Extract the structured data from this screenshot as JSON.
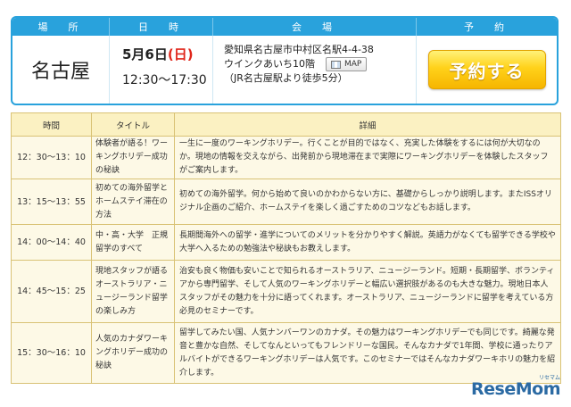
{
  "event": {
    "headers": {
      "venue": "場　所",
      "datetime": "日　時",
      "place": "会　場",
      "reserve": "予　約"
    },
    "venue_city": "名古屋",
    "date_day": "5月6日",
    "date_dow": "(日)",
    "time": "12:30〜17:30",
    "address": "愛知県名古屋市中村区名駅4-4-38",
    "building": "ウインクあいち10階",
    "map_label": "MAP",
    "access": "（JR名古屋駅より徒歩5分）",
    "reserve_button": "予約する"
  },
  "schedule": {
    "headers": {
      "time": "時間",
      "title": "タイトル",
      "detail": "詳細"
    },
    "rows": [
      {
        "time": "12：30〜13：10",
        "title": "体験者が語る！ワーキングホリデー成功の秘訣",
        "detail": "一生に一度のワーキングホリデー。行くことが目的ではなく、充実した体験をするには何が大切なのか。現地の情報を交えながら、出発前から現地滞在まで実際にワーキングホリデーを体験したスタッフがご案内します。"
      },
      {
        "time": "13：15〜13：55",
        "title": "初めての海外留学とホームステイ滞在の方法",
        "detail": "初めての海外留学。何から始めて良いのかわからない方に、基礎からしっかり説明します。またISSオリジナル企画のご紹介、ホームステイを楽しく過ごすためのコツなどもお話します。"
      },
      {
        "time": "14：00〜14：40",
        "title": "中・高・大学　正規留学のすべて",
        "detail": "長期間海外への留学・進学についてのメリットを分かりやすく解説。英語力がなくても留学できる学校や大学へ入るための勉強法や秘訣もお教えします。"
      },
      {
        "time": "14：45〜15：25",
        "title": "現地スタッフが語るオーストラリア・ニュージーランド留学の楽しみ方",
        "detail": "治安も良く物価も安いことで知られるオーストラリア、ニュージーランド。短期・長期留学、ボランティアから専門留学、そして人気のワーキングホリデーと幅広い選択肢があるのも大きな魅力。現地日本人スタッフがその魅力を十分に語ってくれます。オーストラリア、ニュージーランドに留学を考えている方必見のセミナーです。"
      },
      {
        "time": "15：30〜16：10",
        "title": "人気のカナダワーキングホリデー成功の秘訣",
        "detail": "留学してみたい国、人気ナンバーワンのカナダ。その魅力はワーキングホリデーでも同じです。綺麗な発音と豊かな自然、そしてなんといってもフレンドリーな国民。そんなカナダで1年間、学校に通ったりアルバイトができるワーキングホリデーは人気です。このセミナーではそんなカナダワーキホリの魅力を紹介します。"
      }
    ]
  },
  "watermark": {
    "logo": "ReseMom",
    "sub": "リセマム"
  }
}
